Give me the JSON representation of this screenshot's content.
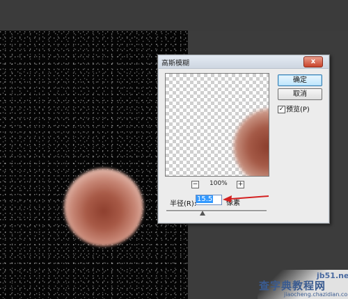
{
  "dialog": {
    "title": "高斯模糊",
    "close_label": "x",
    "ok_label": "确定",
    "cancel_label": "取消",
    "preview_label": "预览(P)",
    "preview_checked": true,
    "zoom_out_label": "−",
    "zoom_in_label": "+",
    "zoom_value": "100%",
    "radius_label": "半径(R):",
    "radius_value": "15.5",
    "radius_unit": "像素",
    "slider_level": 0.36
  },
  "colors": {
    "annotation_arrow": "#d42020",
    "ok_button_border": "#3c7fb1",
    "selection": "#3399ff"
  },
  "watermark": {
    "site": "jb51.net",
    "cn_text": "查字典教程网",
    "url": "jiaocheng.chazidian.com"
  }
}
